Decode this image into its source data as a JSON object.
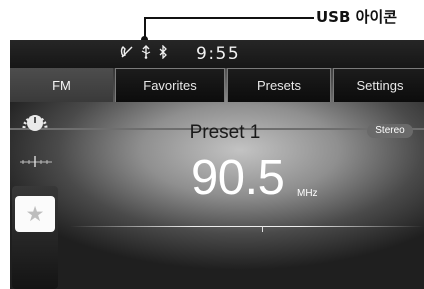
{
  "callout": {
    "label": "USB 아이콘"
  },
  "status_bar": {
    "time": "9:55",
    "icons": [
      "phone-signal-icon",
      "usb-icon",
      "bluetooth-icon"
    ]
  },
  "tabs": [
    {
      "label": "FM",
      "active": true
    },
    {
      "label": "Favorites",
      "active": false
    },
    {
      "label": "Presets",
      "active": false
    },
    {
      "label": "Settings",
      "active": false
    }
  ],
  "radio": {
    "preset_name": "Preset 1",
    "stereo_label": "Stereo",
    "frequency": "90.5",
    "unit": "MHz"
  },
  "side_controls": {
    "favorite_icon": "star-icon",
    "tune_icon": "dial-icon",
    "scale_icon": "tuning-scale-icon"
  }
}
